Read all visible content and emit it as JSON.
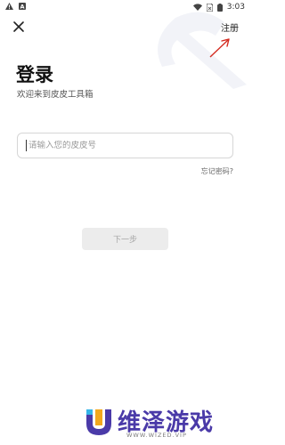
{
  "status_bar": {
    "time": "3:03",
    "icons": [
      "warning-icon",
      "a-icon",
      "wifi-icon",
      "sim-icon",
      "battery-icon"
    ]
  },
  "header": {
    "close_icon": "close-icon",
    "register_label": "注册"
  },
  "login": {
    "title": "登录",
    "subtitle": "欢迎来到皮皮工具箱",
    "input_placeholder": "请输入您的皮皮号",
    "input_value": "",
    "forgot_label": "忘记密码?",
    "next_label": "下一步"
  },
  "watermark": {
    "text": "维泽游戏",
    "subtext": "WWW.WIZED.VIP"
  },
  "colors": {
    "annotation_arrow": "#d42b20",
    "watermark": "#4a3aa8",
    "button_disabled_bg": "#ececec"
  }
}
